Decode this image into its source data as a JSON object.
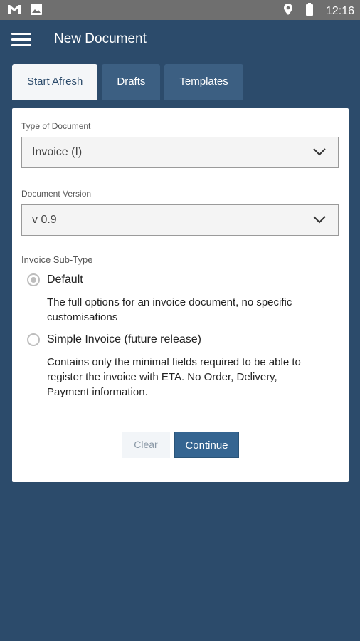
{
  "status_bar": {
    "icons": [
      "gmail-icon",
      "image-icon",
      "location-icon",
      "battery-icon"
    ],
    "time": "12:16"
  },
  "app_bar": {
    "title": "New Document"
  },
  "tabs": [
    {
      "label": "Start Afresh",
      "active": true
    },
    {
      "label": "Drafts",
      "active": false
    },
    {
      "label": "Templates",
      "active": false
    }
  ],
  "form": {
    "type_label": "Type of Document",
    "type_value": "Invoice (I)",
    "version_label": "Document Version",
    "version_value": "v 0.9",
    "subtype_label": "Invoice Sub-Type",
    "options": [
      {
        "label": "Default",
        "selected": true,
        "description": "The full options for an invoice document, no specific customisations"
      },
      {
        "label": "Simple Invoice (future release)",
        "selected": false,
        "description": "Contains only the minimal fields required to be able to register the invoice with ETA. No Order, Delivery, Payment information."
      }
    ]
  },
  "actions": {
    "clear_label": "Clear",
    "continue_label": "Continue"
  },
  "colors": {
    "background": "#2c4b6b",
    "tab_inactive": "#3c5f82",
    "primary_button": "#356591"
  }
}
